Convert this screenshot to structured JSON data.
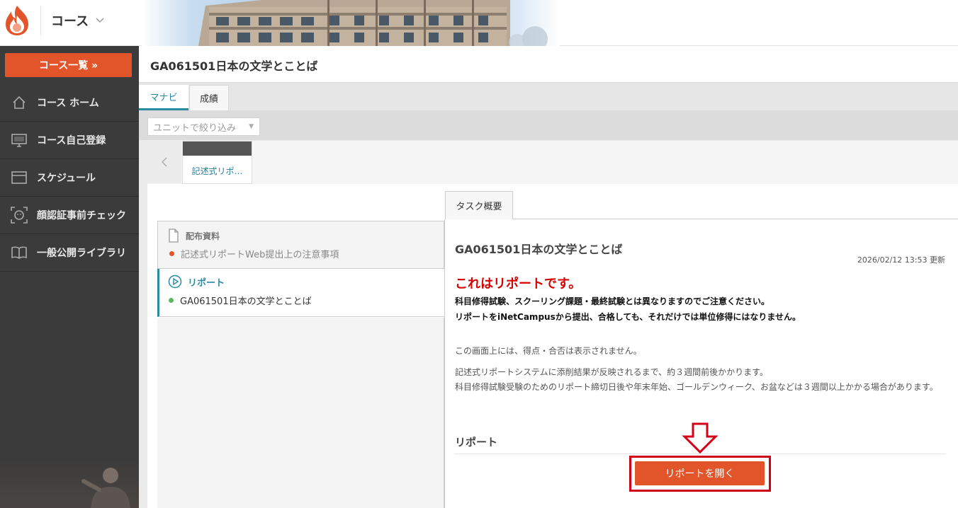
{
  "header": {
    "course_menu_label": "コース",
    "logo_icon": "flame-logo-icon",
    "chevron_icon": "chevron-down-icon"
  },
  "sidebar": {
    "course_list_button": "コース一覧 »",
    "items": [
      {
        "label": "コース ホーム",
        "icon": "home-icon"
      },
      {
        "label": "コース自己登録",
        "icon": "monitor-icon"
      },
      {
        "label": "スケジュール",
        "icon": "calendar-icon"
      },
      {
        "label": "顔認証事前チェック",
        "icon": "face-scan-icon"
      },
      {
        "label": "一般公開ライブラリ",
        "icon": "book-icon"
      }
    ]
  },
  "main": {
    "title": "GA061501日本の文学とことば",
    "tabs": [
      {
        "label": "マナビ",
        "active": true
      },
      {
        "label": "成績",
        "active": false
      }
    ],
    "unit_filter_placeholder": "ユニットで絞り込み",
    "unit_tab_label": "記述式リポ…",
    "materials": {
      "heading": "配布資料",
      "item": "記述式リポートWeb提出上の注意事項"
    },
    "report": {
      "heading": "リポート",
      "item": "GA061501日本の文学とことば"
    },
    "task_tab": "タスク概要",
    "detail": {
      "title": "GA061501日本の文学とことば",
      "updated": "2026/02/12 13:53 更新",
      "warning": "これはリポートです。",
      "bold_line_1": "科目修得試験、スクーリング課題・最終試験とは異なりますのでご注意ください。",
      "bold_line_2": "リポートをiNetCampusから提出、合格しても、それだけでは単位修得にはなりません。",
      "note_1": "この画面上には、得点・合否は表示されません。",
      "note_2": "記述式リポートシステムに添削結果が反映されるまで、約３週間前後かかります。",
      "note_3": "科目修得試験受験のためのリポート締切日後や年末年始、ゴールデンウィーク、お盆などは３週間以上かかる場合があります。",
      "section_heading": "リポート",
      "open_report_button": "リポートを開く"
    }
  },
  "colors": {
    "accent_orange": "#e2542a",
    "teal": "#2a8aa0",
    "warning_red": "#d50000",
    "highlight_red": "#d3001a",
    "sidebar_bg": "#3b3b3b"
  }
}
